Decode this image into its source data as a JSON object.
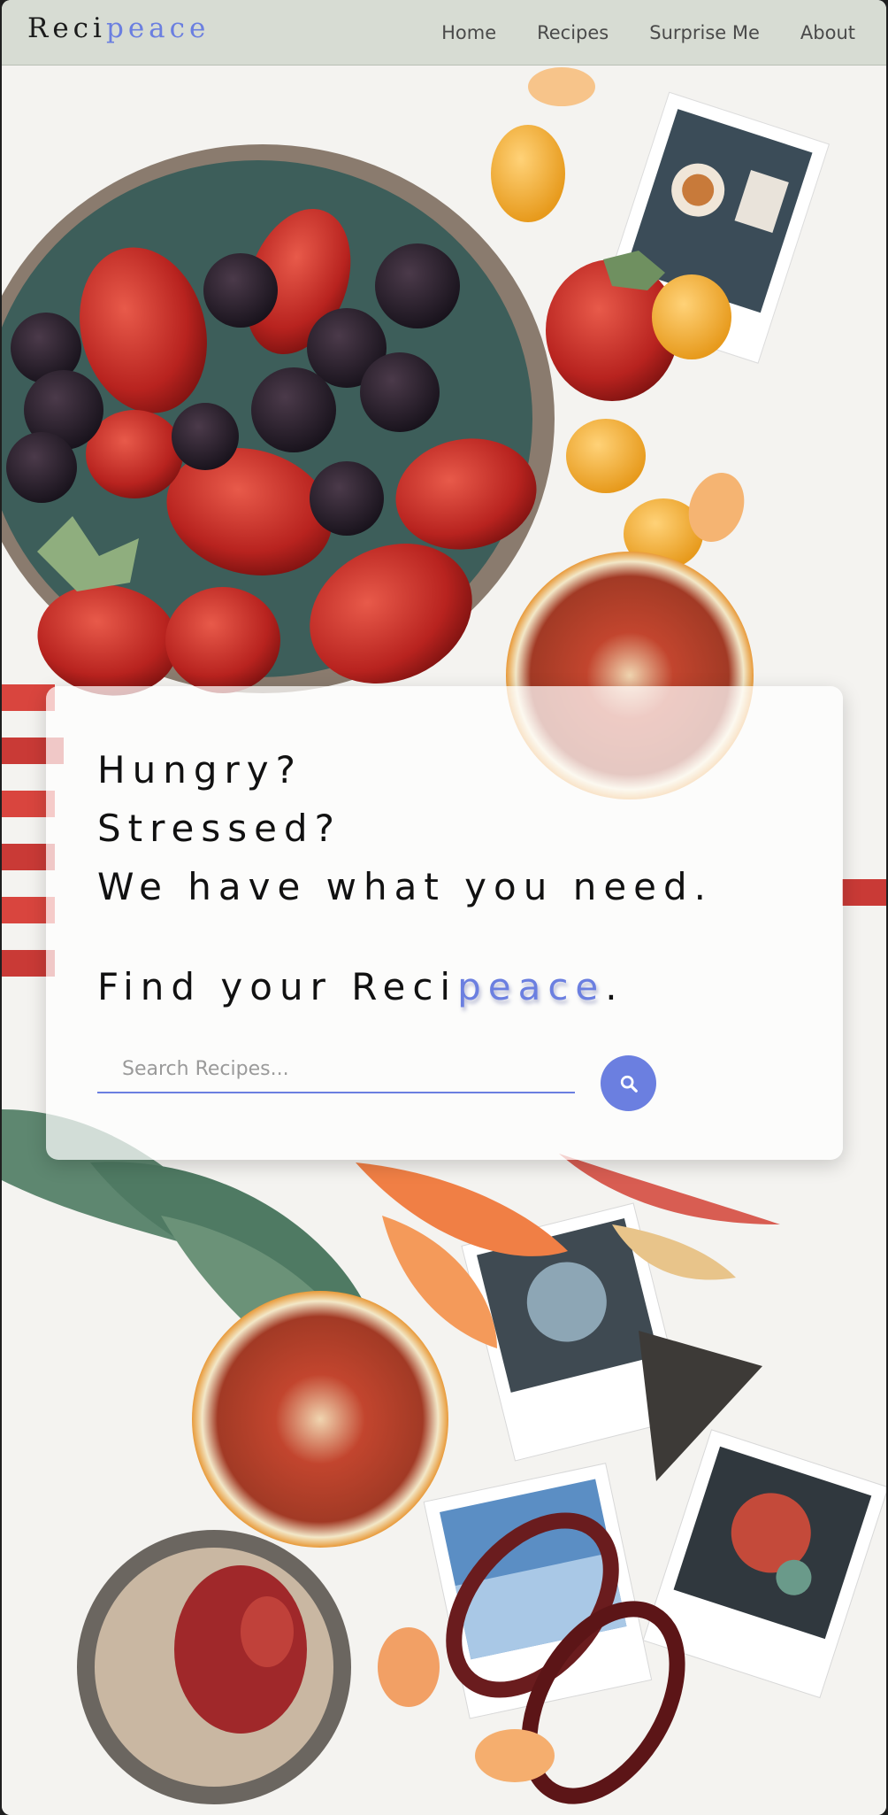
{
  "brand": {
    "prefix": "Reci",
    "accent": "peace"
  },
  "nav": {
    "items": [
      {
        "label": "Home"
      },
      {
        "label": "Recipes"
      },
      {
        "label": "Surprise Me"
      },
      {
        "label": "About"
      }
    ]
  },
  "hero": {
    "lines": [
      "Hungry?",
      "Stressed?",
      "We have what you need."
    ],
    "tagline_prefix": "Find your Reci",
    "tagline_accent": "peace",
    "tagline_suffix": ".",
    "search": {
      "placeholder": "Search Recipes...",
      "value": ""
    },
    "search_icon": "search-icon"
  },
  "colors": {
    "accent": "#6b7fe0",
    "nav_bg": "#d7dcd3",
    "text": "#111111"
  }
}
